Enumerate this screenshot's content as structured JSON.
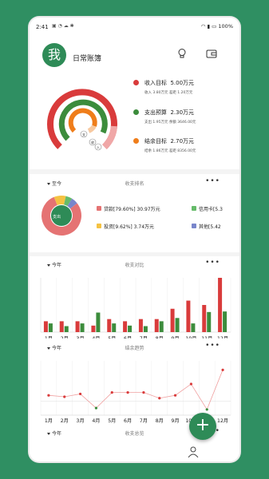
{
  "status": {
    "time": "2:41",
    "icons": "▣ ◔ ☁ ✱",
    "battery": "100%"
  },
  "header": {
    "avatar": "我",
    "title": "日常账簿",
    "bulb_icon": "lightbulb-icon",
    "wallet_icon": "wallet-icon"
  },
  "summary": {
    "ring_labels": {
      "expense": "支",
      "income": "收",
      "income2": "入"
    },
    "income": {
      "label": "收入目标",
      "amount": "5.00万元",
      "sub": "收入  3.80万元        差距  1.20万元",
      "color": "#d93b3b"
    },
    "budget": {
      "label": "支出预算",
      "amount": "2.30万元",
      "sub": "支出  1.95万元        余额  3646.00元",
      "color": "#3c8c3c"
    },
    "surplus": {
      "label": "结余目标",
      "amount": "2.70万元",
      "sub": "结余  1.86万元        差距  8356.00元",
      "color": "#ef7d1a"
    }
  },
  "ranking": {
    "period": "至今",
    "title": "收支排名",
    "more": "•••",
    "center": "支出",
    "items": [
      {
        "label": "贷款[79.60%] 30.97万元",
        "color": "#e57373"
      },
      {
        "label": "信用卡[5.3",
        "color": "#66bb6a"
      },
      {
        "label": "投资[9.62%] 3.74万元",
        "color": "#f5c242"
      },
      {
        "label": "其他[5.42",
        "color": "#7986cb"
      }
    ]
  },
  "compare": {
    "period": "今年",
    "title": "收支对比",
    "more": "•••"
  },
  "trend": {
    "period": "今年",
    "title": "结余趋势",
    "more": "•••"
  },
  "overview": {
    "period": "今年",
    "title": "收支总览",
    "more": "•••"
  },
  "fab": "+",
  "chart_data": [
    {
      "type": "pie",
      "title": "收支排名",
      "categories": [
        "贷款",
        "投资",
        "信用卡",
        "其他"
      ],
      "values": [
        79.6,
        9.62,
        5.36,
        5.42
      ],
      "colors": [
        "#e57373",
        "#f5c242",
        "#66bb6a",
        "#7986cb"
      ]
    },
    {
      "type": "bar",
      "title": "收支对比",
      "categories": [
        "1月",
        "2月",
        "3月",
        "4月",
        "5月",
        "6月",
        "7月",
        "8月",
        "9月",
        "10月",
        "11月",
        "12月"
      ],
      "series": [
        {
          "values": [
            2.0,
            2.0,
            2.0,
            1.2,
            2.4,
            2.0,
            2.4,
            2.4,
            4.3,
            5.8,
            5.0,
            10.0
          ],
          "color": "#d93b3b"
        },
        {
          "values": [
            1.6,
            1.1,
            1.6,
            3.6,
            1.6,
            1.2,
            1.1,
            2.0,
            2.6,
            1.6,
            3.7,
            3.8
          ],
          "color": "#3c8c3c"
        }
      ]
    },
    {
      "type": "line",
      "title": "结余趋势",
      "categories": [
        "1月",
        "2月",
        "3月",
        "4月",
        "5月",
        "6月",
        "7月",
        "8月",
        "9月",
        "10月",
        "11月",
        "12月"
      ],
      "values": [
        0.4,
        0.3,
        0.5,
        -0.5,
        0.6,
        0.6,
        0.6,
        0.2,
        0.4,
        1.2,
        -0.6,
        2.2
      ]
    }
  ]
}
